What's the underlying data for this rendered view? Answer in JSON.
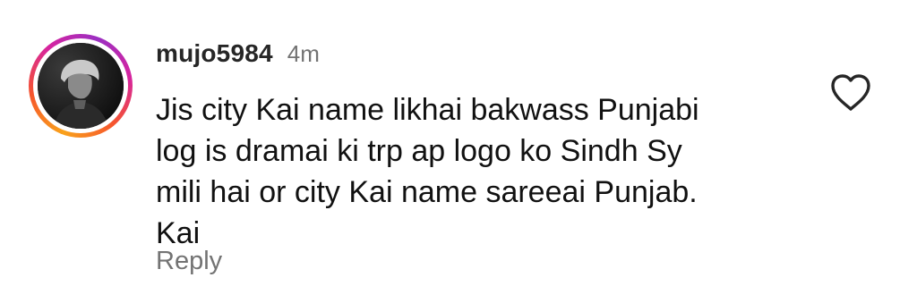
{
  "comment": {
    "username": "mujo5984",
    "time": "4m",
    "text_lines": [
      "Jis city Kai name likhai bakwass Punjabi",
      "log is dramai ki trp ap logo ko Sindh Sy",
      "mili hai or city Kai name sareeai Punjab.",
      "Kai"
    ],
    "reply_label": "Reply",
    "like_icon": "heart-outline-icon",
    "avatar_icon": "user-avatar-photo"
  },
  "colors": {
    "username": "#262626",
    "secondary_text": "#737373",
    "story_ring": [
      "#f9a21b",
      "#f6552c",
      "#d6249f",
      "#9b2fc2"
    ]
  }
}
